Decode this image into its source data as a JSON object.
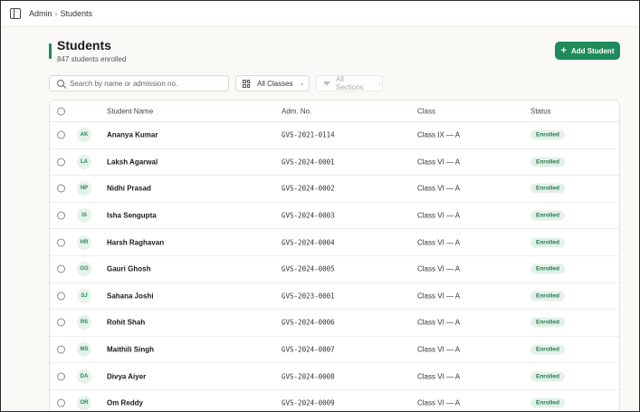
{
  "breadcrumb": {
    "parent": "Admin",
    "separator": "›",
    "current": "Students"
  },
  "page": {
    "title": "Students",
    "subtitle": "847 students enrolled",
    "accent_color": "#1f8a5b"
  },
  "actions": {
    "add_student_label": "Add Student",
    "add_icon": "plus-icon"
  },
  "filters": {
    "search_placeholder": "Search by name or admission no.",
    "class_select": "All Classes",
    "section_select": "All Sections"
  },
  "table": {
    "columns": {
      "name": "Student Name",
      "adm": "Adm. No.",
      "class": "Class",
      "status": "Status"
    },
    "rows": [
      {
        "initials": "AK",
        "name": "Ananya Kumar",
        "adm": "GVS-2021-0114",
        "class": "Class IX — A",
        "status": "Enrolled"
      },
      {
        "initials": "LA",
        "name": "Laksh Agarwal",
        "adm": "GVS-2024-0001",
        "class": "Class VI — A",
        "status": "Enrolled"
      },
      {
        "initials": "NP",
        "name": "Nidhi Prasad",
        "adm": "GVS-2024-0002",
        "class": "Class VI — A",
        "status": "Enrolled"
      },
      {
        "initials": "IS",
        "name": "Isha Sengupta",
        "adm": "GVS-2024-0003",
        "class": "Class VI — A",
        "status": "Enrolled"
      },
      {
        "initials": "HR",
        "name": "Harsh Raghavan",
        "adm": "GVS-2024-0004",
        "class": "Class VI — A",
        "status": "Enrolled"
      },
      {
        "initials": "GG",
        "name": "Gauri Ghosh",
        "adm": "GVS-2024-0005",
        "class": "Class VI — A",
        "status": "Enrolled"
      },
      {
        "initials": "SJ",
        "name": "Sahana Joshi",
        "adm": "GVS-2023-0001",
        "class": "Class VI — A",
        "status": "Enrolled"
      },
      {
        "initials": "RS",
        "name": "Rohit Shah",
        "adm": "GVS-2024-0006",
        "class": "Class VI — A",
        "status": "Enrolled"
      },
      {
        "initials": "MS",
        "name": "Maithili Singh",
        "adm": "GVS-2024-0007",
        "class": "Class VI — A",
        "status": "Enrolled"
      },
      {
        "initials": "DA",
        "name": "Divya Aiyer",
        "adm": "GVS-2024-0008",
        "class": "Class VI — A",
        "status": "Enrolled"
      },
      {
        "initials": "OR",
        "name": "Om Reddy",
        "adm": "GVS-2024-0009",
        "class": "Class VI — A",
        "status": "Enrolled"
      }
    ]
  }
}
